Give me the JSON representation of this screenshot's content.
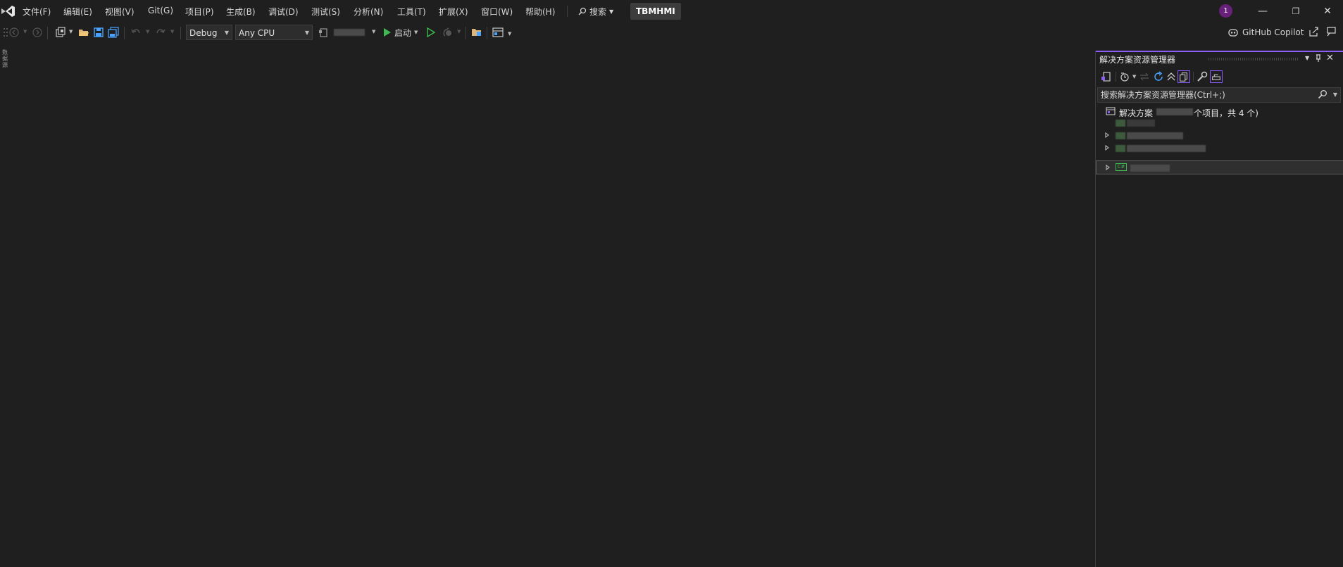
{
  "menu": {
    "items": [
      {
        "id": "file",
        "label": "文件(F)"
      },
      {
        "id": "edit",
        "label": "编辑(E)"
      },
      {
        "id": "view",
        "label": "视图(V)"
      },
      {
        "id": "git",
        "label": "Git(G)"
      },
      {
        "id": "project",
        "label": "项目(P)"
      },
      {
        "id": "build",
        "label": "生成(B)"
      },
      {
        "id": "debug",
        "label": "调试(D)"
      },
      {
        "id": "test",
        "label": "测试(S)"
      },
      {
        "id": "analyze",
        "label": "分析(N)"
      },
      {
        "id": "tools",
        "label": "工具(T)"
      },
      {
        "id": "extensions",
        "label": "扩展(X)"
      },
      {
        "id": "window",
        "label": "窗口(W)"
      },
      {
        "id": "help",
        "label": "帮助(H)"
      }
    ],
    "search_label": "搜索",
    "solution_name": "TBMHMI",
    "notification_count": "1"
  },
  "toolbar": {
    "configuration": "Debug",
    "platform": "Any CPU",
    "start_label": "启动",
    "copilot_label": "GitHub Copilot"
  },
  "left_strip": {
    "label": "数据源"
  },
  "solution_explorer": {
    "title": "解决方案资源管理器",
    "search_placeholder": "搜索解决方案资源管理器(Ctrl+;)",
    "root_label_prefix": "解决方案",
    "root_label_suffix": "个项目，共 4 个)",
    "project_type_badge": "C#",
    "accent_color": "#8b5cf6"
  },
  "colors": {
    "background": "#1f1f1f",
    "play_green": "#3fb950",
    "notification_purple": "#68217a"
  }
}
